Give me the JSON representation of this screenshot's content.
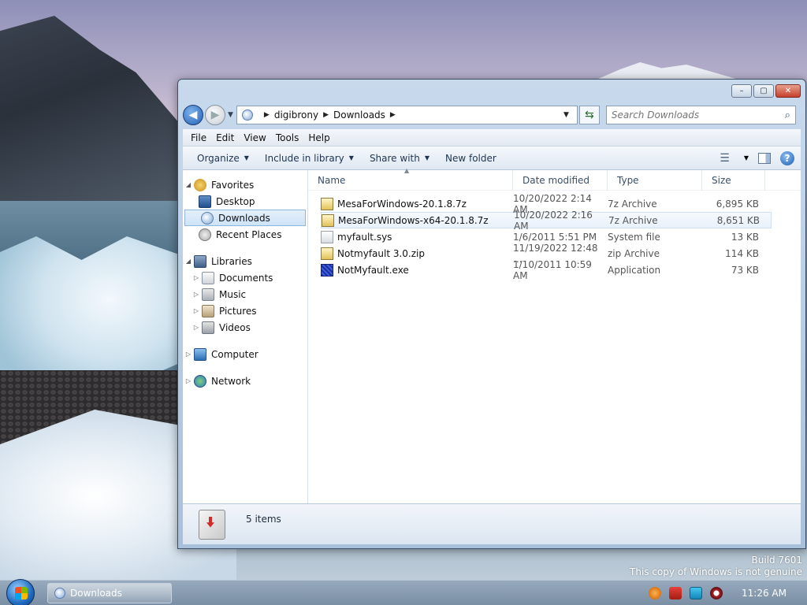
{
  "window": {
    "title": "Downloads",
    "caption": {
      "minimize": "–",
      "maximize": "▢",
      "close": "✕"
    }
  },
  "nav": {
    "back": "◀",
    "forward": "▶",
    "breadcrumb": [
      "digibrony",
      "Downloads"
    ],
    "search_placeholder": "Search Downloads"
  },
  "menubar": [
    "File",
    "Edit",
    "View",
    "Tools",
    "Help"
  ],
  "toolbar": {
    "organize": "Organize",
    "include_in_library": "Include in library",
    "share_with": "Share with",
    "new_folder": "New folder",
    "help": "?"
  },
  "navpane": {
    "favorites": "Favorites",
    "desktop": "Desktop",
    "downloads": "Downloads",
    "recent_places": "Recent Places",
    "libraries": "Libraries",
    "documents": "Documents",
    "music": "Music",
    "pictures": "Pictures",
    "videos": "Videos",
    "computer": "Computer",
    "network": "Network"
  },
  "columns": {
    "name": "Name",
    "date": "Date modified",
    "type": "Type",
    "size": "Size"
  },
  "files": [
    {
      "name": "MesaForWindows-20.1.8.7z",
      "date": "10/20/2022 2:14 AM",
      "type": "7z Archive",
      "size": "6,895 KB",
      "icon": "7z-archive-icon"
    },
    {
      "name": "MesaForWindows-x64-20.1.8.7z",
      "date": "10/20/2022 2:16 AM",
      "type": "7z Archive",
      "size": "8,651 KB",
      "icon": "7z-archive-icon"
    },
    {
      "name": "myfault.sys",
      "date": "1/6/2011 5:51 PM",
      "type": "System file",
      "size": "13 KB",
      "icon": "system-file-icon"
    },
    {
      "name": "Notmyfault 3.0.zip",
      "date": "11/19/2022 12:48 ...",
      "type": "zip Archive",
      "size": "114 KB",
      "icon": "zip-archive-icon"
    },
    {
      "name": "NotMyfault.exe",
      "date": "1/10/2011 10:59 AM",
      "type": "Application",
      "size": "73 KB",
      "icon": "application-icon"
    }
  ],
  "details": {
    "items_count": "5 items"
  },
  "watermark": {
    "build": "Build 7601",
    "genuine": "This copy of Windows is not genuine"
  },
  "taskbar": {
    "task_label": "Downloads",
    "clock": "11:26 AM"
  }
}
